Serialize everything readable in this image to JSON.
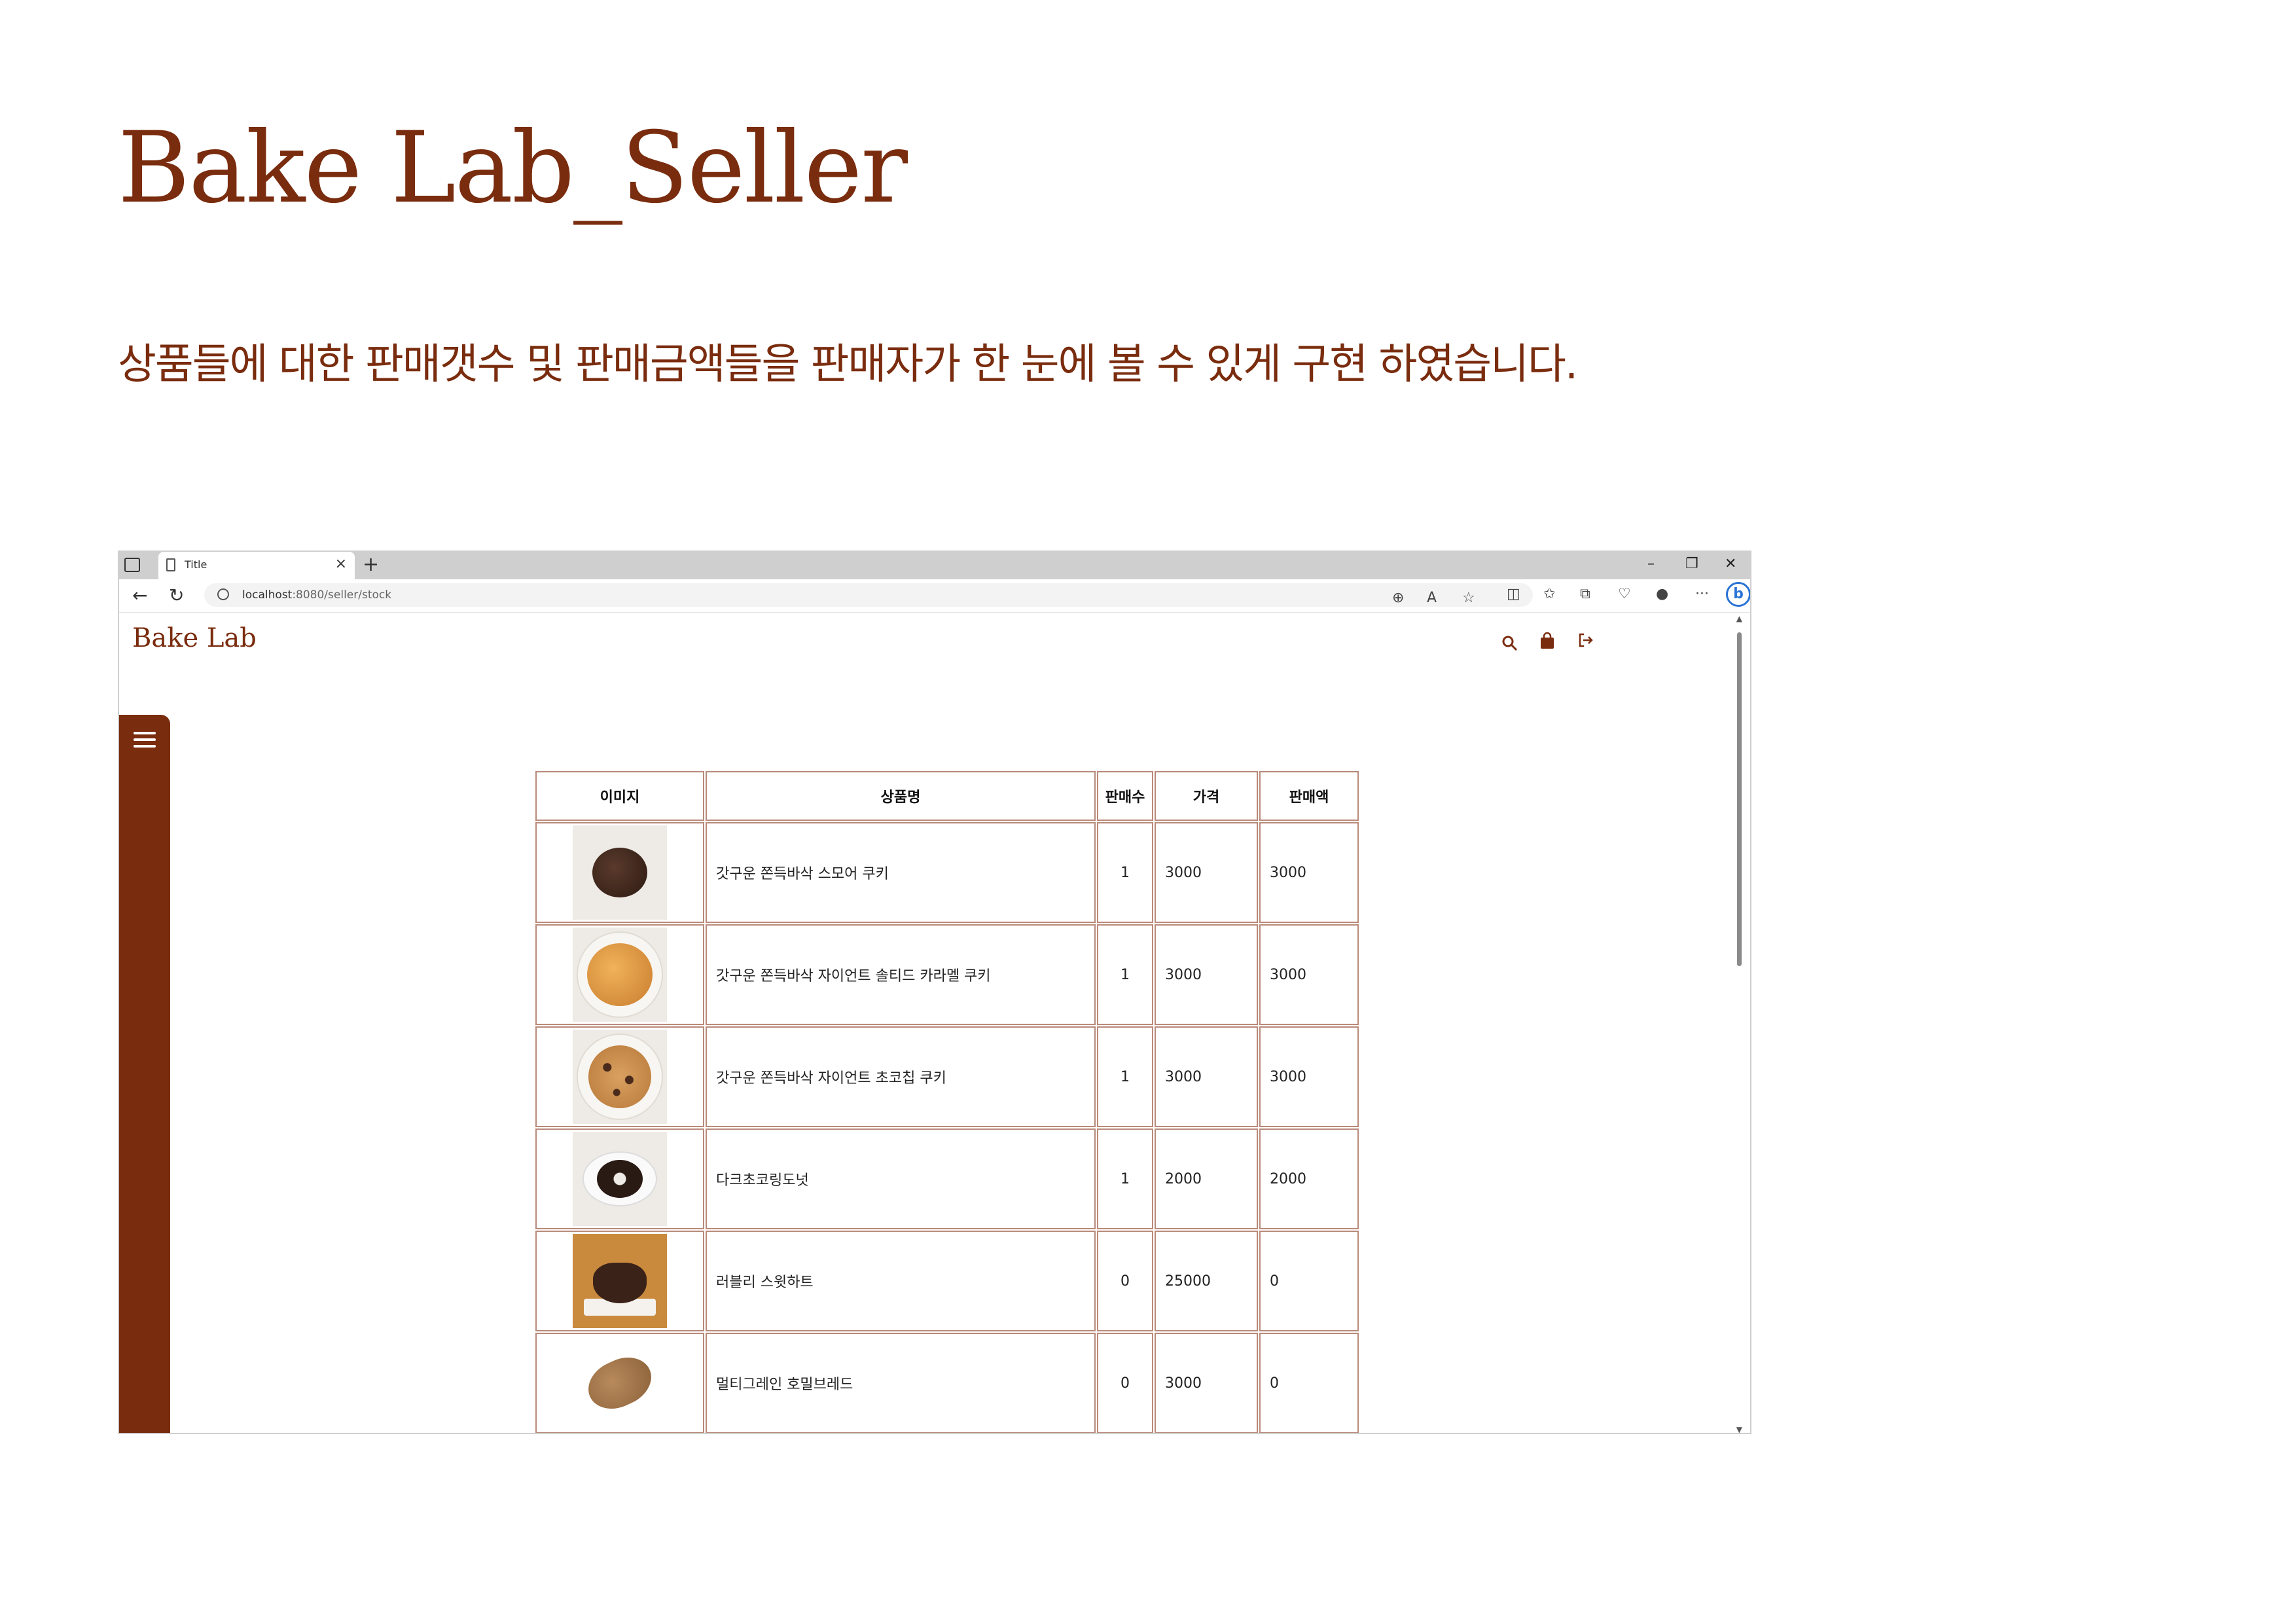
{
  "slide": {
    "title": "Bake Lab_Seller",
    "description": "상품들에 대한 판매갯수 및 판매금액들을 판매자가 한 눈에 볼 수 있게 구현 하였습니다."
  },
  "browser": {
    "tab_title": "Title",
    "url_host": "localhost",
    "url_rest": ":8080/seller/stock",
    "colors": {
      "accent": "#7a2c0e",
      "border": "#b98a7a"
    }
  },
  "site": {
    "logo": "Bake Lab",
    "icons": [
      "search-icon",
      "shopping-bag-icon",
      "logout-icon",
      "hamburger-menu-icon"
    ]
  },
  "table": {
    "headers": {
      "image": "이미지",
      "name": "상품명",
      "sold": "판매수",
      "price": "가격",
      "sales": "판매액"
    },
    "rows": [
      {
        "name": "갓구운 쫀득바삭 스모어 쿠키",
        "sold": "1",
        "price": "3000",
        "sales": "3000",
        "image": "dark-cookie"
      },
      {
        "name": "갓구운 쫀득바삭 자이언트 솔티드 카라멜 쿠키",
        "sold": "1",
        "price": "3000",
        "sales": "3000",
        "image": "caramel-cookie"
      },
      {
        "name": "갓구운 쫀득바삭 자이언트 초코칩 쿠키",
        "sold": "1",
        "price": "3000",
        "sales": "3000",
        "image": "chocochip-cookie"
      },
      {
        "name": "다크초코링도넛",
        "sold": "1",
        "price": "2000",
        "sales": "2000",
        "image": "choco-donut"
      },
      {
        "name": "러블리 스윗하트",
        "sold": "0",
        "price": "25000",
        "sales": "0",
        "image": "heart-cake"
      },
      {
        "name": "멀티그레인 호밀브레드",
        "sold": "0",
        "price": "3000",
        "sales": "0",
        "image": "rye-bread"
      }
    ]
  }
}
